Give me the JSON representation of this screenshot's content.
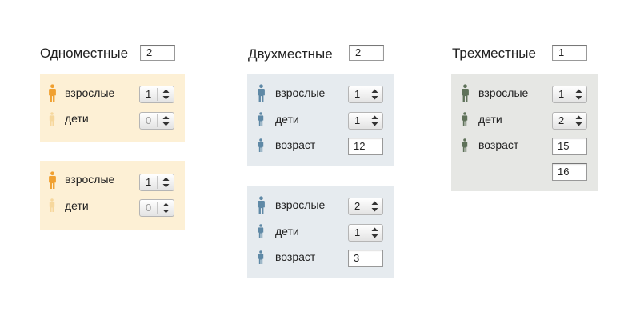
{
  "colors": {
    "single_panel_bg": "#fdf0d5",
    "double_panel_bg": "#e6ebef",
    "triple_panel_bg": "#e6e7e4",
    "adult_icon_single": "#f0a030",
    "child_icon_single_disabled": "#f6d79c",
    "person_icon_double": "#5f89a6",
    "person_icon_triple": "#5f725a"
  },
  "rooms": {
    "single": {
      "title": "Одноместные",
      "count": "2",
      "panels": [
        {
          "adults_label": "взрослые",
          "adults_value": "1",
          "children_label": "дети",
          "children_value": "0"
        },
        {
          "adults_label": "взрослые",
          "adults_value": "1",
          "children_label": "дети",
          "children_value": "0"
        }
      ]
    },
    "double": {
      "title": "Двухместные",
      "count": "2",
      "panels": [
        {
          "adults_label": "взрослые",
          "adults_value": "1",
          "children_label": "дети",
          "children_value": "1",
          "age_label": "возраст",
          "ages": [
            "12"
          ]
        },
        {
          "adults_label": "взрослые",
          "adults_value": "2",
          "children_label": "дети",
          "children_value": "1",
          "age_label": "возраст",
          "ages": [
            "3"
          ]
        }
      ]
    },
    "triple": {
      "title": "Трехместные",
      "count": "1",
      "panels": [
        {
          "adults_label": "взрослые",
          "adults_value": "1",
          "children_label": "дети",
          "children_value": "2",
          "age_label": "возраст",
          "ages": [
            "15",
            "16"
          ]
        }
      ]
    }
  }
}
